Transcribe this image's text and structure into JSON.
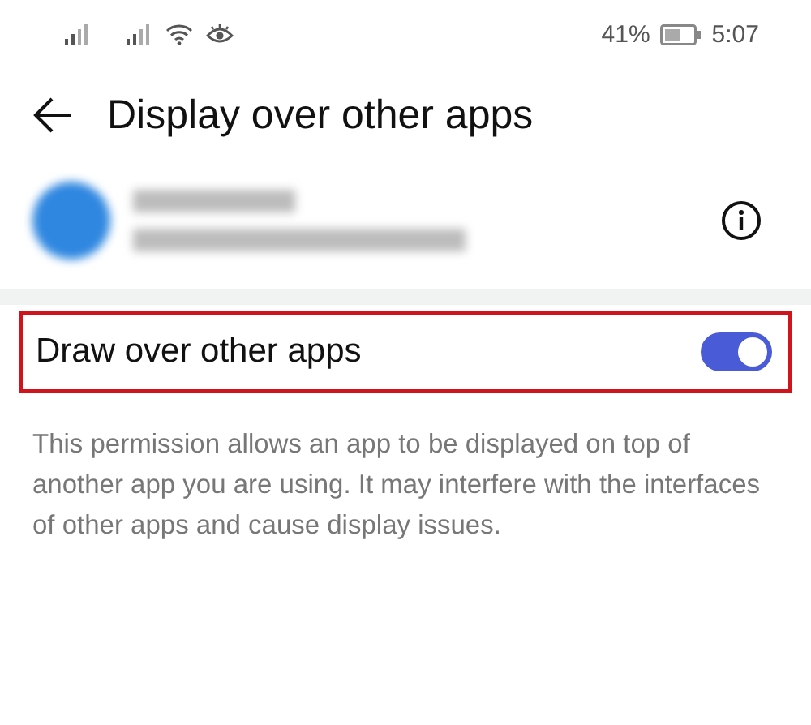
{
  "status_bar": {
    "battery_percent": "41%",
    "time": "5:07"
  },
  "header": {
    "title": "Display over other apps"
  },
  "setting": {
    "label": "Draw over other apps",
    "on": true,
    "highlighted": true
  },
  "description": "This permission allows an app to be displayed on top of another app you are using. It may interfere with the interfaces of other apps and cause display issues."
}
